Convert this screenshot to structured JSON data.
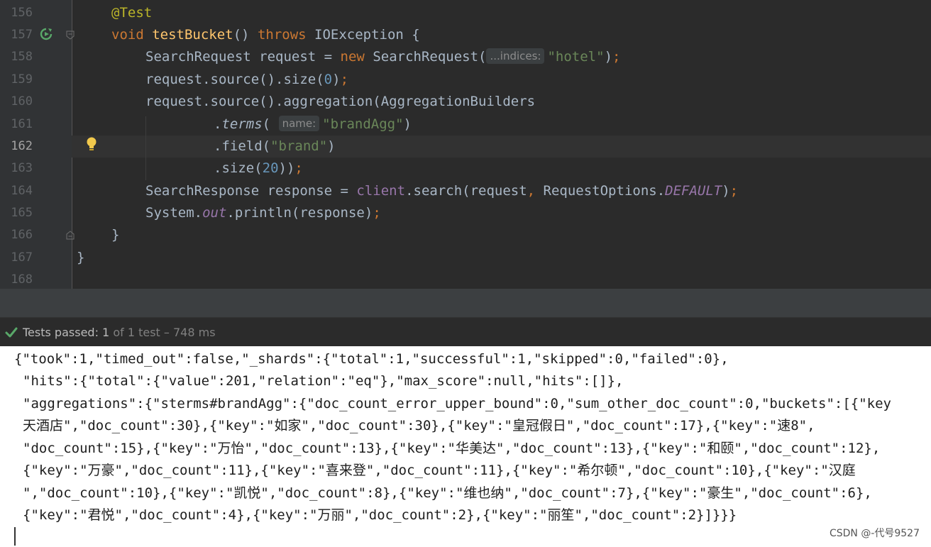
{
  "editor": {
    "line_numbers": [
      "156",
      "157",
      "158",
      "159",
      "160",
      "161",
      "162",
      "163",
      "164",
      "165",
      "166",
      "167",
      "168"
    ],
    "code": {
      "l156": {
        "annotation": "@Test"
      },
      "l157": {
        "void": "void",
        "method": "testBucket",
        "parens": "() ",
        "throws": "throws",
        "exc": " IOException {"
      },
      "l158": {
        "type": "SearchRequest request = ",
        "new": "new",
        "ctor": " SearchRequest(",
        "hint": "...indices:",
        "str": "\"hotel\"",
        "close": ")",
        "semi": ";"
      },
      "l159": {
        "pre": "request.source().size(",
        "num": "0",
        "close": ")",
        "semi": ";"
      },
      "l160": {
        "text": "request.source().aggregation(AggregationBuilders"
      },
      "l161": {
        "dot": ".",
        "method": "terms",
        "open": "(",
        "hint": "name:",
        "str": "\"brandAgg\"",
        "close": ")"
      },
      "l162": {
        "pre": ".field(",
        "str": "\"brand\"",
        "close": ")"
      },
      "l163": {
        "pre": ".size(",
        "num": "20",
        "close": "))",
        "semi": ";"
      },
      "l164": {
        "pre": "SearchResponse response = ",
        "client": "client",
        "mid": ".search(request",
        "comma": ",",
        "mid2": " RequestOptions.",
        "const": "DEFAULT",
        "close": ")",
        "semi": ";"
      },
      "l165": {
        "pre": "System.",
        "out": "out",
        "mid": ".println(response)",
        "semi": ";"
      },
      "l166": {
        "text": "}"
      },
      "l167": {
        "text": "}"
      }
    }
  },
  "test_bar": {
    "label": "Tests passed: ",
    "count": "1",
    "detail": " of 1 test – 748 ms"
  },
  "console": {
    "lines": [
      "{\"took\":1,\"timed_out\":false,\"_shards\":{\"total\":1,\"successful\":1,\"skipped\":0,\"failed\":0},",
      "\"hits\":{\"total\":{\"value\":201,\"relation\":\"eq\"},\"max_score\":null,\"hits\":[]},",
      "\"aggregations\":{\"sterms#brandAgg\":{\"doc_count_error_upper_bound\":0,\"sum_other_doc_count\":0,\"buckets\":[{\"key",
      "天酒店\",\"doc_count\":30},{\"key\":\"如家\",\"doc_count\":30},{\"key\":\"皇冠假日\",\"doc_count\":17},{\"key\":\"速8\",",
      "\"doc_count\":15},{\"key\":\"万怡\",\"doc_count\":13},{\"key\":\"华美达\",\"doc_count\":13},{\"key\":\"和颐\",\"doc_count\":12},",
      "{\"key\":\"万豪\",\"doc_count\":11},{\"key\":\"喜来登\",\"doc_count\":11},{\"key\":\"希尔顿\",\"doc_count\":10},{\"key\":\"汉庭",
      "\",\"doc_count\":10},{\"key\":\"凯悦\",\"doc_count\":8},{\"key\":\"维也纳\",\"doc_count\":7},{\"key\":\"豪生\",\"doc_count\":6},",
      "{\"key\":\"君悦\",\"doc_count\":4},{\"key\":\"万丽\",\"doc_count\":2},{\"key\":\"丽笙\",\"doc_count\":2}]}}}"
    ]
  },
  "watermark": "CSDN @-代号9527",
  "icons": {
    "run": "run-test-icon",
    "bulb": "intention-bulb-icon",
    "check": "check-icon",
    "fold": "fold-marker-icon"
  },
  "colors": {
    "editor_bg": "#2b2b2b",
    "keyword": "#cc7832",
    "string": "#6a8759",
    "number": "#6897bb",
    "method": "#ffc66d",
    "annotation": "#bbb529",
    "pass_green": "#59a869"
  }
}
